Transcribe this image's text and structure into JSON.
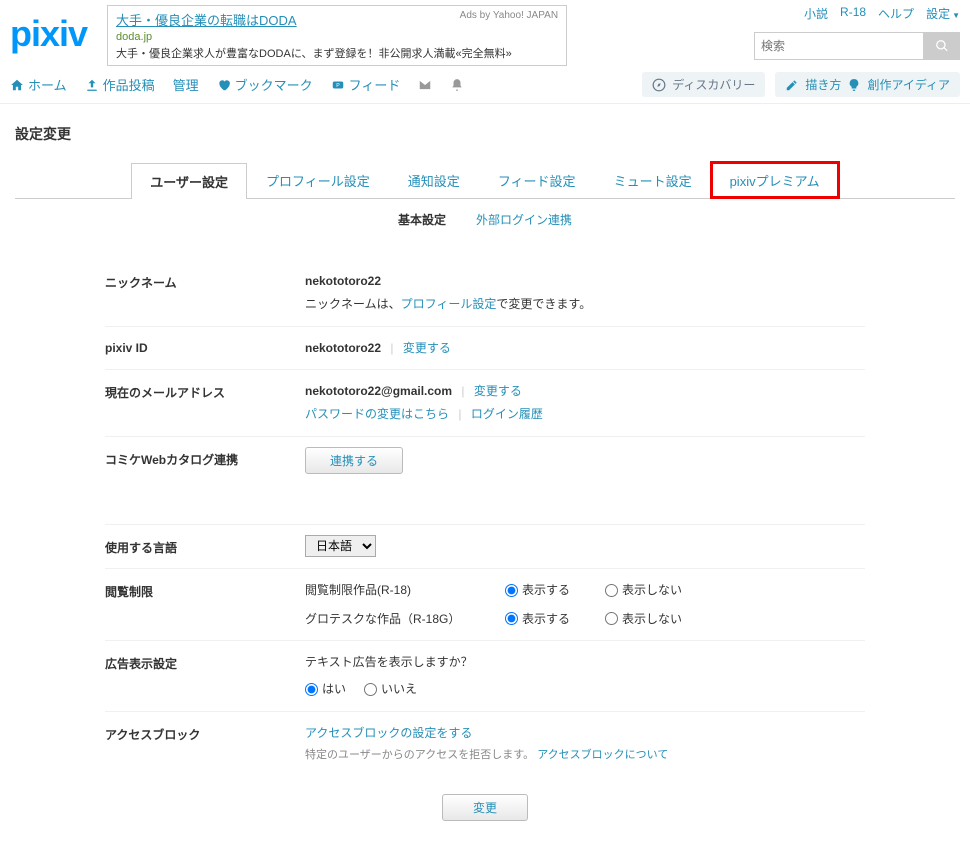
{
  "logo": "pixiv",
  "ad": {
    "title": "大手・優良企業の転職はDODA",
    "domain": "doda.jp",
    "desc": "大手・優良企業求人が豊富なDODAに、まず登録を！非公開求人満載«完全無料»",
    "by": "Ads by Yahoo! JAPAN"
  },
  "top_links": {
    "novel": "小説",
    "r18": "R-18",
    "help": "ヘルプ",
    "settings": "設定"
  },
  "search": {
    "placeholder": "検索"
  },
  "nav": {
    "home": "ホーム",
    "post": "作品投稿",
    "manage": "管理",
    "bookmark": "ブックマーク",
    "feed": "フィード"
  },
  "nav_right": {
    "discovery": "ディスカバリー",
    "how_to_draw": "描き方",
    "ideas": "創作アイディア"
  },
  "page_title": "設定変更",
  "tabs": {
    "user": "ユーザー設定",
    "profile": "プロフィール設定",
    "notify": "通知設定",
    "feed": "フィード設定",
    "mute": "ミュート設定",
    "premium": "pixivプレミアム"
  },
  "subtabs": {
    "basic": "基本設定",
    "external": "外部ログイン連携"
  },
  "rows": {
    "nickname": {
      "label": "ニックネーム",
      "value": "nekototoro22",
      "note_prefix": "ニックネームは、",
      "link": "プロフィール設定",
      "note_suffix": "で変更できます。"
    },
    "pixiv_id": {
      "label": "pixiv ID",
      "value": "nekototoro22",
      "change": "変更する"
    },
    "email": {
      "label": "現在のメールアドレス",
      "value": "nekototoro22@gmail.com",
      "change": "変更する",
      "pw": "パスワードの変更はこちら",
      "login_history": "ログイン履歴"
    },
    "comiket": {
      "label": "コミケWebカタログ連携",
      "button": "連携する"
    },
    "language": {
      "label": "使用する言語",
      "selected": "日本語"
    },
    "view_restrict": {
      "label": "閲覧制限",
      "r18_label": "閲覧制限作品(R-18)",
      "r18g_label": "グロテスクな作品（R-18G）",
      "show": "表示する",
      "hide": "表示しない"
    },
    "ads": {
      "label": "広告表示設定",
      "question": "テキスト広告を表示しますか？",
      "yes": "はい",
      "no": "いいえ"
    },
    "block": {
      "label": "アクセスブロック",
      "link": "アクセスブロックの設定をする",
      "desc_prefix": "特定のユーザーからのアクセスを拒否します。",
      "desc_link": "アクセスブロックについて"
    }
  },
  "submit": "変更"
}
